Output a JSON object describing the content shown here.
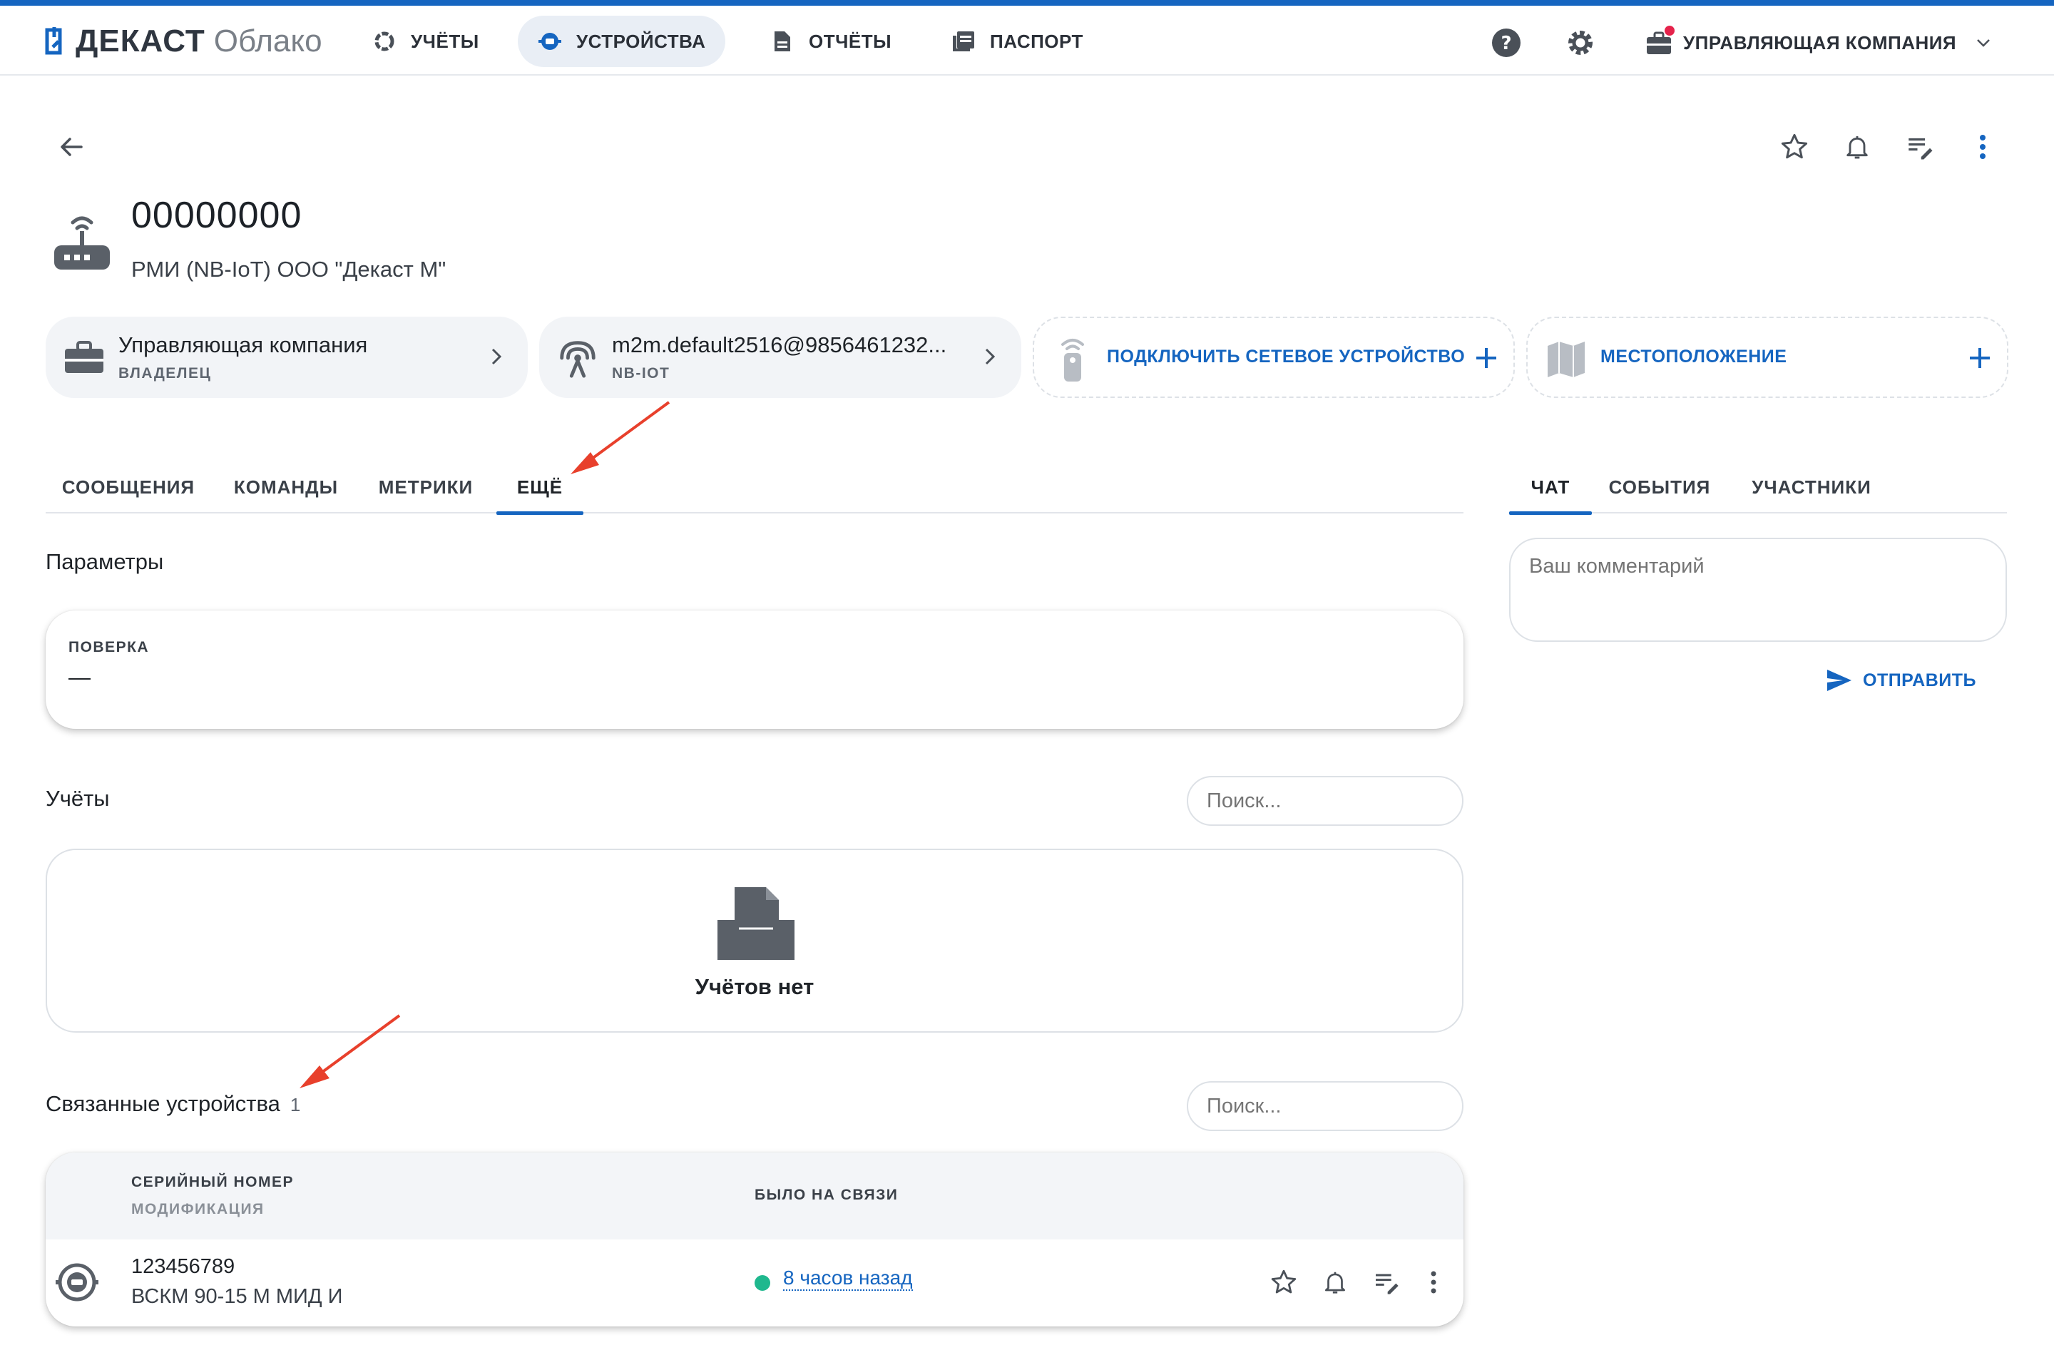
{
  "app": {
    "brand": "ДЕКАСТ",
    "product": "Облако"
  },
  "nav": {
    "items": [
      {
        "label": "УЧЁТЫ",
        "icon": "accounting-icon"
      },
      {
        "label": "УСТРОЙСТВА",
        "icon": "device-icon",
        "active": true
      },
      {
        "label": "ОТЧЁТЫ",
        "icon": "report-icon"
      },
      {
        "label": "ПАСПОРТ",
        "icon": "passport-icon"
      }
    ],
    "company": "УПРАВЛЯЮЩАЯ КОМПАНИЯ"
  },
  "device": {
    "serial": "00000000",
    "model": "РМИ (NB-IoT) ООО \"Декаст М\""
  },
  "cards": {
    "owner": {
      "title": "Управляющая компания",
      "subtitle": "ВЛАДЕЛЕЦ"
    },
    "network": {
      "title": "m2m.default2516@9856461232...",
      "subtitle": "NB-IOT"
    },
    "connect": {
      "label": "ПОДКЛЮЧИТЬ СЕТЕВОЕ УСТРОЙСТВО"
    },
    "location": {
      "label": "МЕСТОПОЛОЖЕНИЕ"
    }
  },
  "tabs": {
    "left": [
      "СООБЩЕНИЯ",
      "КОМАНДЫ",
      "МЕТРИКИ",
      "ЕЩЁ"
    ],
    "left_active": "ЕЩЁ",
    "right": [
      "ЧАТ",
      "СОБЫТИЯ",
      "УЧАСТНИКИ"
    ],
    "right_active": "ЧАТ"
  },
  "parameters": {
    "title": "Параметры",
    "fields": [
      {
        "label": "ПОВЕРКА",
        "value": "—"
      }
    ]
  },
  "accounts": {
    "title": "Учёты",
    "search_placeholder": "Поиск...",
    "empty_text": "Учётов нет"
  },
  "related": {
    "title": "Связанные устройства",
    "count": "1",
    "search_placeholder": "Поиск...",
    "columns": {
      "serial": "СЕРИЙНЫЙ НОМЕР",
      "modification": "МОДИФИКАЦИЯ",
      "last_seen": "БЫЛО НА СВЯЗИ"
    },
    "rows": [
      {
        "serial": "123456789",
        "modification": "ВСКМ 90-15 М МИД И",
        "last_seen": "8 часов назад",
        "status_color": "#1fb88e"
      }
    ]
  },
  "chat": {
    "placeholder": "Ваш комментарий",
    "send_label": "ОТПРАВИТЬ"
  },
  "colors": {
    "accent": "#1565c0",
    "annotation_arrow": "#e8402c",
    "online": "#1fb88e"
  }
}
